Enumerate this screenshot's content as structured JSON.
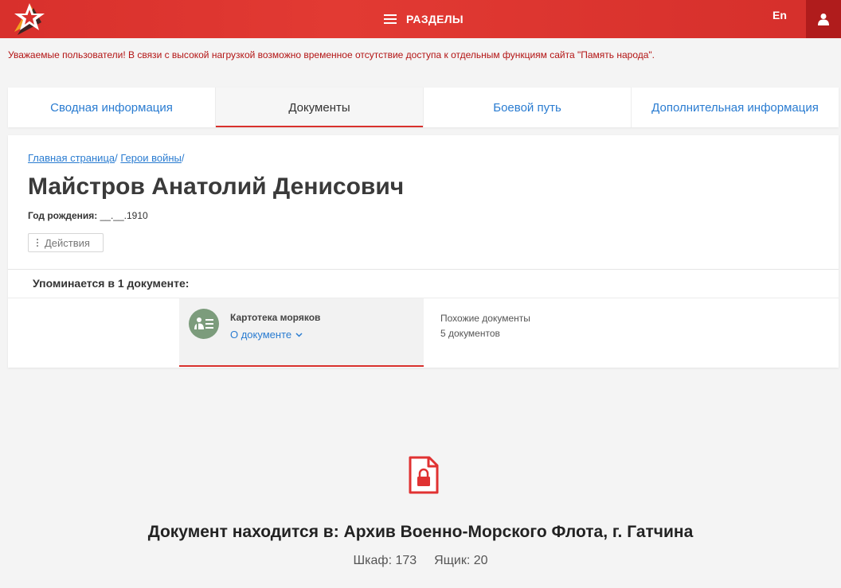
{
  "header": {
    "logo_icon": "star-ribbon-logo-icon",
    "sections_label": "РАЗДЕЛЫ",
    "lang_label": "En",
    "user_icon": "user-icon",
    "brand_color": "#d8302c"
  },
  "notice": "Уважаемые пользователи! В связи с высокой нагрузкой возможно временное отсутствие доступа к отдельным функциям сайта \"Память народа\".",
  "tabs": [
    {
      "label": "Сводная информация",
      "active": false
    },
    {
      "label": "Документы",
      "active": true
    },
    {
      "label": "Боевой путь",
      "active": false
    },
    {
      "label": "Дополнительная информация",
      "active": false
    }
  ],
  "breadcrumb": {
    "home": "Главная страница",
    "heroes": "Герои войны"
  },
  "person": {
    "name": "Майстров Анатолий Денисович",
    "birth_label": "Год рождения:",
    "birth_value": "__.__.1910"
  },
  "actions_label": "Действия",
  "mentions_label": "Упоминается в 1 документе:",
  "document": {
    "icon": "person-card-icon",
    "title": "Картотека моряков",
    "about_label": "О документе"
  },
  "similar": {
    "label": "Похожие документы",
    "count": "5 документов"
  },
  "archive": {
    "icon": "locked-document-icon",
    "location": "Документ находится в: Архив Военно-Морского Флота, г. Гатчина",
    "shelf": "Шкаф: 173",
    "box": "Ящик: 20"
  }
}
